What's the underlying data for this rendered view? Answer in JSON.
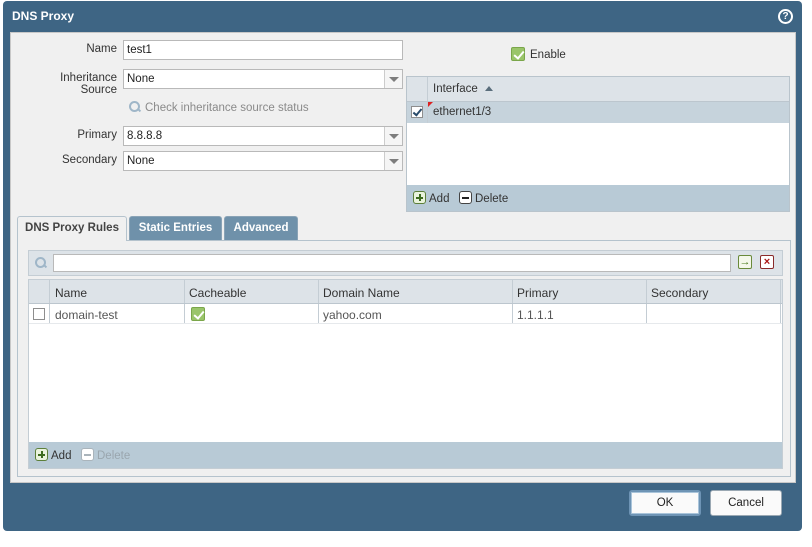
{
  "dialog": {
    "title": "DNS Proxy",
    "help_icon": "?"
  },
  "form": {
    "name_label": "Name",
    "name_value": "test1",
    "inheritance_label": "Inheritance Source",
    "inheritance_value": "None",
    "check_inheritance": "Check inheritance source status",
    "primary_label": "Primary",
    "primary_value": "8.8.8.8",
    "secondary_label": "Secondary",
    "secondary_value": "None"
  },
  "enable": {
    "label": "Enable",
    "checked": true
  },
  "interface_grid": {
    "header": "Interface",
    "rows": [
      {
        "value": "ethernet1/3",
        "checked": true
      }
    ],
    "add_label": "Add",
    "delete_label": "Delete"
  },
  "tabs": [
    {
      "label": "DNS Proxy Rules",
      "active": true
    },
    {
      "label": "Static Entries",
      "active": false
    },
    {
      "label": "Advanced",
      "active": false
    }
  ],
  "rules": {
    "search_value": "",
    "columns": [
      "Name",
      "Cacheable",
      "Domain Name",
      "Primary",
      "Secondary"
    ],
    "rows": [
      {
        "name": "domain-test",
        "cacheable": true,
        "domain_name": "yahoo.com",
        "primary": "1.1.1.1",
        "secondary": ""
      }
    ],
    "add_label": "Add",
    "delete_label": "Delete"
  },
  "buttons": {
    "ok": "OK",
    "cancel": "Cancel"
  }
}
